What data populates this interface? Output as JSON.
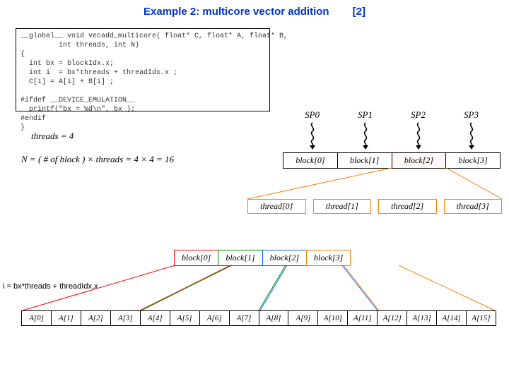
{
  "title": "Example 2: multicore vector addition",
  "title_ref": "[2]",
  "code": "__global__ void vecadd_multicore( float* C, float* A, float* B,\n         int threads, int N)\n{\n  int bx = blockIdx.x;\n  int i  = bx*threads + threadIdx.x ;\n  C[i] = A[i] + B[i] ;\n\n#ifdef __DEVICE_EMULATION__\n  printf(\"bx = %d\\n\", bx );\n#endif\n}",
  "eq_threads": "threads = 4",
  "eq_N": "N = ( # of block ) × threads = 4 × 4 = 16",
  "sp_labels": [
    "SP0",
    "SP1",
    "SP2",
    "SP3"
  ],
  "blocks1": [
    "block[0]",
    "block[1]",
    "block[2]",
    "block[3]"
  ],
  "threads": [
    "thread[0]",
    "thread[1]",
    "thread[2]",
    "thread[3]"
  ],
  "blocks2": [
    "block[0]",
    "block[1]",
    "block[2]",
    "block[3]"
  ],
  "index_eq": "i = bx*threads + threadIdx.x",
  "array": [
    "A[0]",
    "A[1]",
    "A[2]",
    "A[3]",
    "A[4]",
    "A[5]",
    "A[6]",
    "A[7]",
    "A[8]",
    "A[9]",
    "A[10]",
    "A[11]",
    "A[12]",
    "A[13]",
    "A[14]",
    "A[15]"
  ],
  "block2_colors": [
    "#ff0000",
    "#009900",
    "#0066ff",
    "#ff7f00"
  ]
}
